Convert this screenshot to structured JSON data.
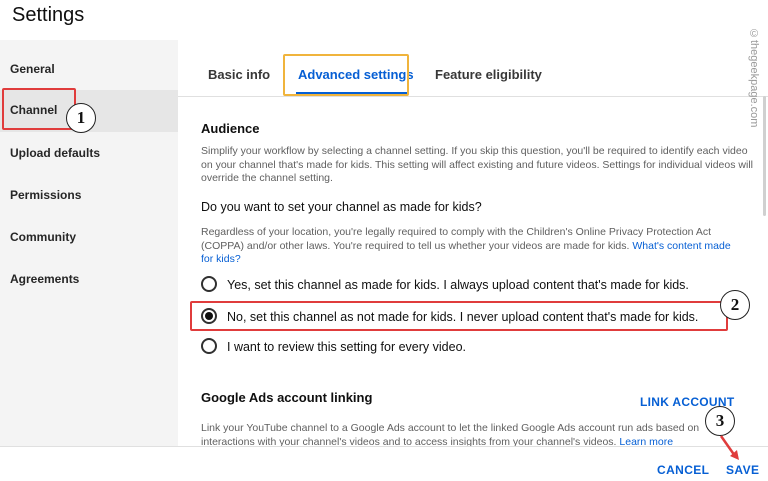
{
  "window": {
    "title": "Settings"
  },
  "sidebar": {
    "items": [
      {
        "label": "General"
      },
      {
        "label": "Channel"
      },
      {
        "label": "Upload defaults"
      },
      {
        "label": "Permissions"
      },
      {
        "label": "Community"
      },
      {
        "label": "Agreements"
      }
    ],
    "active": "Channel"
  },
  "tabs": [
    {
      "label": "Basic info"
    },
    {
      "label": "Advanced settings"
    },
    {
      "label": "Feature eligibility"
    }
  ],
  "active_tab": "Advanced settings",
  "audience": {
    "title": "Audience",
    "description": "Simplify your workflow by selecting a channel setting. If you skip this question, you'll be required to identify each video on your channel that's made for kids. This setting will affect existing and future videos. Settings for individual videos will override the channel setting.",
    "question": "Do you want to set your channel as made for kids?",
    "legal_text": "Regardless of your location, you're legally required to comply with the Children's Online Privacy Protection Act (COPPA) and/or other laws. You're required to tell us whether your videos are made for kids.",
    "legal_link": "What's content made for kids?",
    "options": [
      {
        "label": "Yes, set this channel as made for kids. I always upload content that's made for kids.",
        "checked": false
      },
      {
        "label": "No, set this channel as not made for kids. I never upload content that's made for kids.",
        "checked": true
      },
      {
        "label": "I want to review this setting for every video.",
        "checked": false
      }
    ]
  },
  "ads": {
    "title": "Google Ads account linking",
    "link_button": "LINK ACCOUNT",
    "description": "Link your YouTube channel to a Google Ads account to let the linked Google Ads account run ads based on interactions with your channel's videos and to access insights from your channel's videos.",
    "learn_more": "Learn more"
  },
  "footer": {
    "cancel": "CANCEL",
    "save": "SAVE"
  },
  "annotations": {
    "badge1": "1",
    "badge2": "2",
    "badge3": "3"
  },
  "watermark": "©thegeekpage.com",
  "colors": {
    "accent": "#065fd4",
    "annotation_red": "#e03c3c",
    "annotation_orange": "#f0b43c"
  }
}
